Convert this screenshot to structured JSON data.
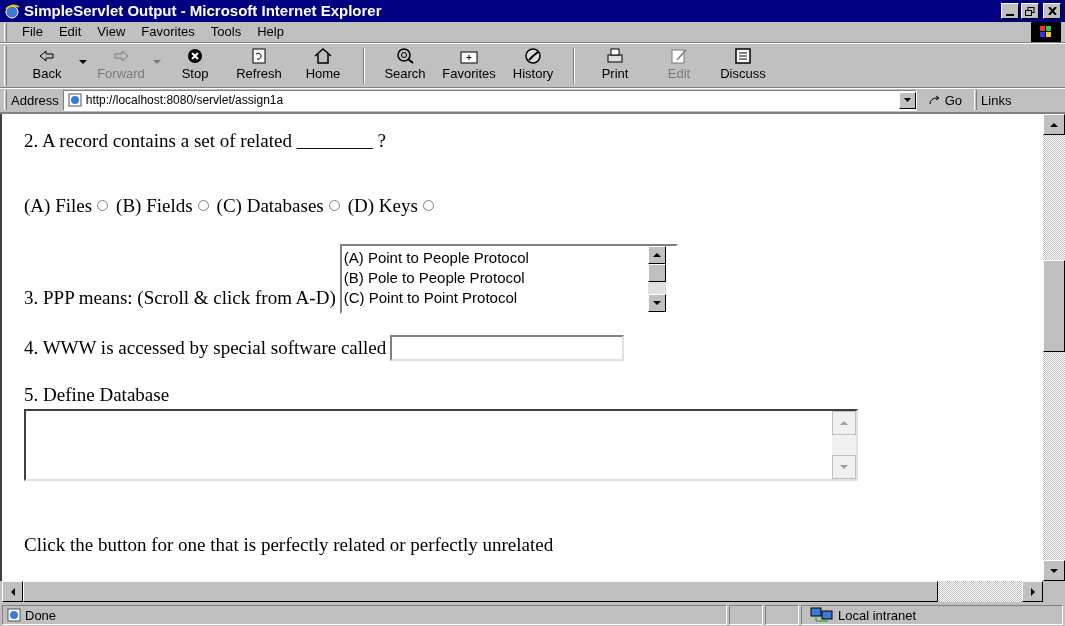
{
  "window": {
    "title": "SimpleServlet Output - Microsoft Internet Explorer"
  },
  "menu": [
    "File",
    "Edit",
    "View",
    "Favorites",
    "Tools",
    "Help"
  ],
  "toolbar": [
    {
      "label": "Back",
      "kind": "back",
      "disabled": false,
      "dropdown": true
    },
    {
      "label": "Forward",
      "kind": "forward",
      "disabled": true,
      "dropdown": true
    },
    {
      "label": "Stop",
      "kind": "stop",
      "disabled": false,
      "dropdown": false
    },
    {
      "label": "Refresh",
      "kind": "refresh",
      "disabled": false,
      "dropdown": false
    },
    {
      "label": "Home",
      "kind": "home",
      "disabled": false,
      "dropdown": false
    },
    {
      "label": "Search",
      "kind": "search",
      "disabled": false,
      "dropdown": false
    },
    {
      "label": "Favorites",
      "kind": "favorites",
      "disabled": false,
      "dropdown": false
    },
    {
      "label": "History",
      "kind": "history",
      "disabled": false,
      "dropdown": false
    },
    {
      "label": "Print",
      "kind": "print",
      "disabled": false,
      "dropdown": false
    },
    {
      "label": "Edit",
      "kind": "edit",
      "disabled": true,
      "dropdown": false
    },
    {
      "label": "Discuss",
      "kind": "discuss",
      "disabled": false,
      "dropdown": false
    }
  ],
  "address_bar": {
    "label": "Address",
    "url": "http://localhost:8080/servlet/assign1a",
    "go": "Go",
    "links": "Links"
  },
  "page": {
    "q2": {
      "text": "2. A record contains a set of related ________ ?",
      "options": [
        {
          "label": "(A) Files",
          "selected": false
        },
        {
          "label": "(B) Fields",
          "selected": false
        },
        {
          "label": "(C) Databases",
          "selected": false
        },
        {
          "label": "(D) Keys",
          "selected": false
        }
      ]
    },
    "q3": {
      "text": "3. PPP means: (Scroll & click from A-D)",
      "options": [
        {
          "label": "(A) Point to People Protocol",
          "selected": false
        },
        {
          "label": "(B) Pole to People Protocol",
          "selected": false
        },
        {
          "label": "(C) Point to Point Protocol",
          "selected": false
        }
      ]
    },
    "q4": {
      "text": "4. WWW is accessed by special software called"
    },
    "q5": {
      "text": "5. Define Database"
    },
    "instruction": "Click the button for one that is perfectly related or perfectly unrelated"
  },
  "status_bar": {
    "text": "Done",
    "zone": "Local intranet"
  }
}
